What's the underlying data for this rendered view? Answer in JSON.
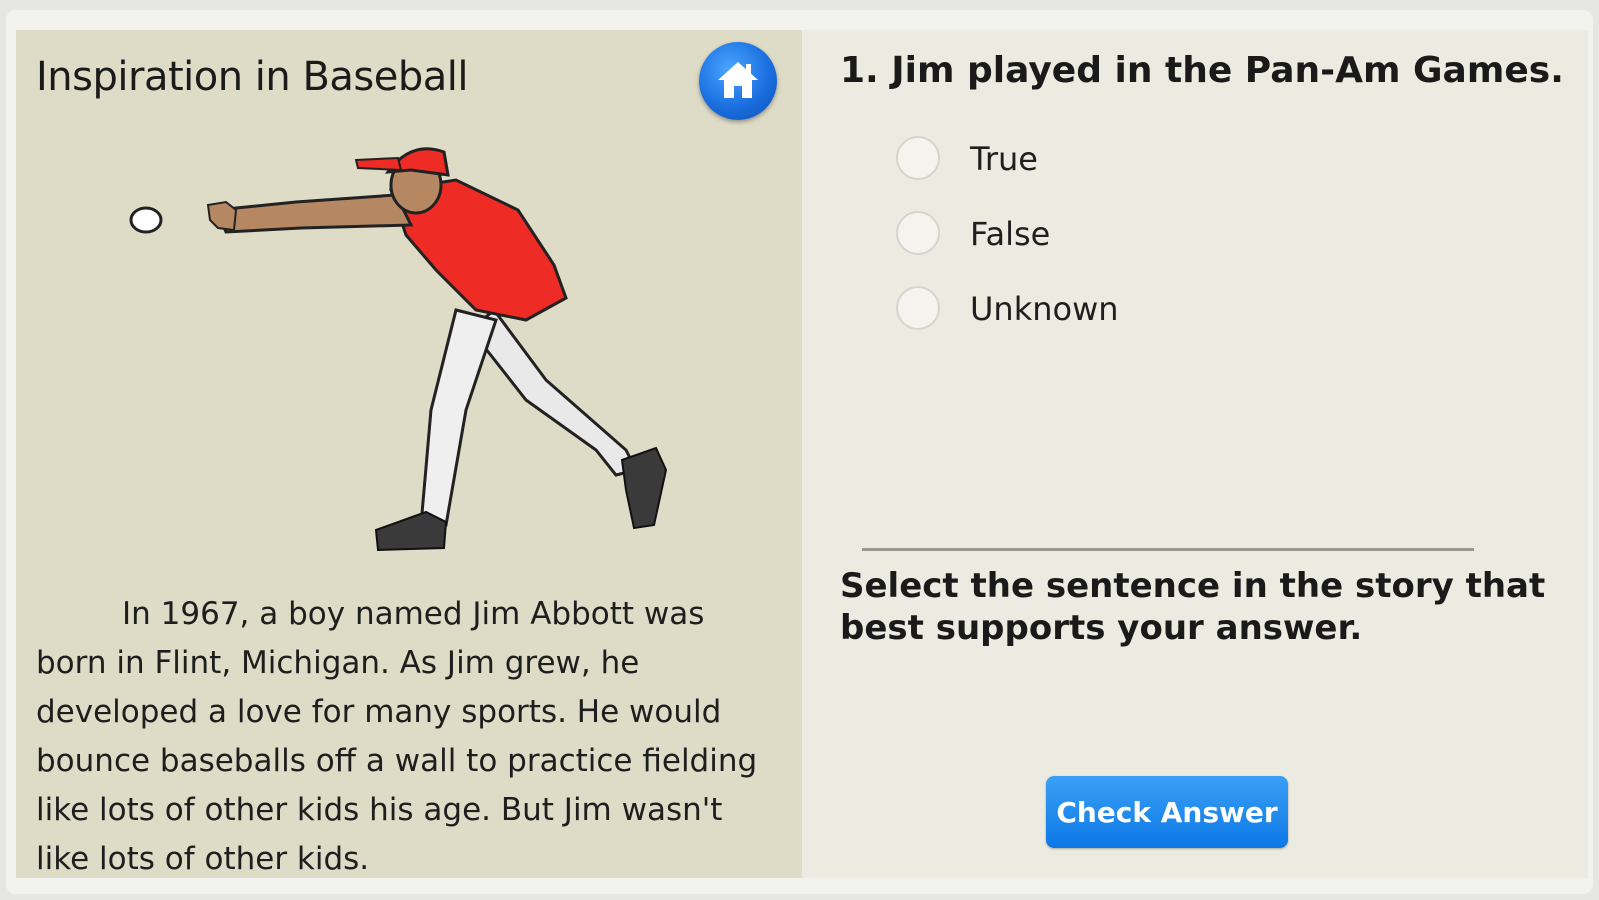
{
  "story": {
    "title": "Inspiration in Baseball",
    "text": "In 1967, a boy named Jim Abbott was born in Flint, Michigan.  As Jim grew, he developed a love for many sports.  He would bounce baseballs off a wall to practice fielding like lots of other kids his age.  But Jim wasn't like lots of other kids."
  },
  "question": {
    "text": "1.  Jim played in the Pan-Am Games.",
    "options": [
      {
        "label": "True"
      },
      {
        "label": "False"
      },
      {
        "label": "Unknown"
      }
    ],
    "instruction": "Select the sentence in the story that best supports your answer.",
    "check_label": "Check Answer"
  },
  "colors": {
    "accent": "#0c78e6",
    "left_panel": "#dedbc6",
    "right_panel": "#ecebe1",
    "jersey": "#ee2b24"
  }
}
